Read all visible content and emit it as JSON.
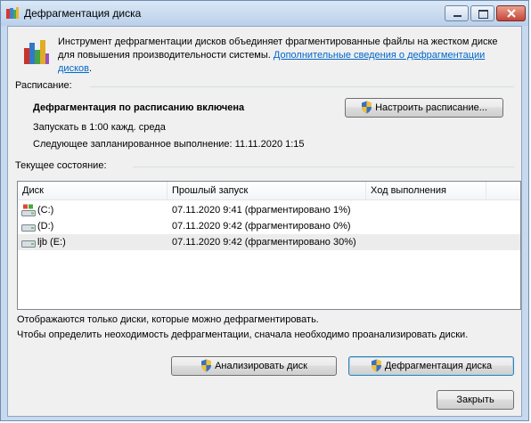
{
  "window": {
    "title": "Дефрагментация диска"
  },
  "intro": {
    "text": "Инструмент дефрагментации дисков объединяет фрагментированные файлы на жестком диске для повышения производительности системы. ",
    "link": "Дополнительные сведения о дефрагментации дисков",
    "suffix": "."
  },
  "schedule": {
    "label": "Расписание:",
    "status": "Дефрагментация по расписанию включена",
    "run": "Запускать в 1:00 кажд. среда",
    "next": "Следующее запланированное выполнение: 11.11.2020 1:15",
    "configure_button": "Настроить расписание..."
  },
  "current": {
    "label": "Текущее состояние:"
  },
  "table": {
    "columns": [
      "Диск",
      "Прошлый запуск",
      "Ход выполнения"
    ],
    "rows": [
      {
        "disk": "(C:)",
        "last_run": "07.11.2020 9:41 (фрагментировано 1%)",
        "progress": "",
        "icon": "system-drive-icon"
      },
      {
        "disk": "(D:)",
        "last_run": "07.11.2020 9:42 (фрагментировано 0%)",
        "progress": "",
        "icon": "hard-drive-icon"
      },
      {
        "disk": "ljb (E:)",
        "last_run": "07.11.2020 9:42 (фрагментировано 30%)",
        "progress": "",
        "icon": "hard-drive-icon"
      }
    ]
  },
  "notes": {
    "line1": "Отображаются только диски, которые можно дефрагментировать.",
    "line2": "Чтобы определить неоходимость  дефрагментации, сначала необходимо проанализировать диски."
  },
  "buttons": {
    "analyze": "Анализировать диск",
    "defragment": "Дефрагментация диска",
    "close": "Закрыть"
  },
  "colors": {
    "link": "#0066cc",
    "selected_row": "#ececec",
    "frame": "#c7d9ee"
  }
}
